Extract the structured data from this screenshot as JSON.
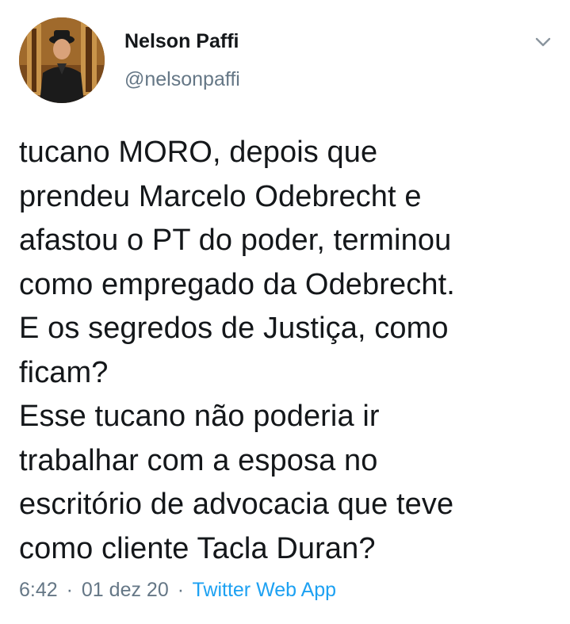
{
  "tweet": {
    "author": {
      "display_name": "Nelson Paffi",
      "handle": "@nelsonpaffi"
    },
    "text": "tucano MORO, depois que\nprendeu Marcelo Odebrecht e\nafastou o PT do poder, terminou\ncomo empregado da Odebrecht.\nE os segredos de Justiça, como\nficam?\nEsse tucano não poderia ir\ntrabalhar com a esposa no\nescritório de advocacia que teve\ncomo cliente Tacla Duran?",
    "time": "6:42",
    "separator": "·",
    "date": "01 dez 20",
    "source": "Twitter Web App"
  },
  "icons": {
    "menu_caret": "chevron-down-icon"
  },
  "colors": {
    "text": "#14171a",
    "secondary": "#657786",
    "link": "#1da1f2",
    "background": "#ffffff"
  }
}
